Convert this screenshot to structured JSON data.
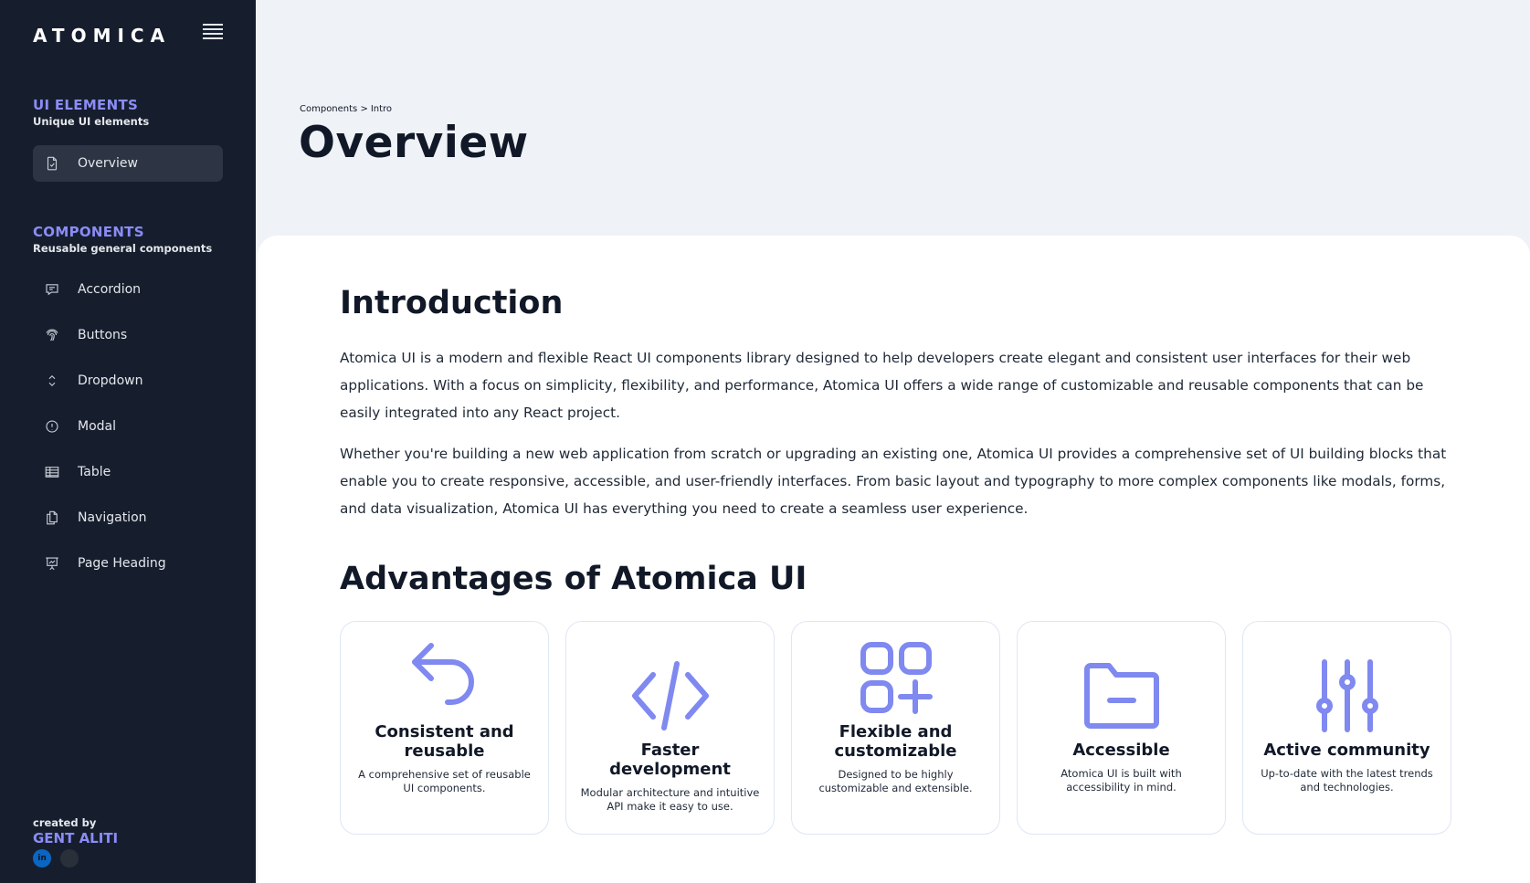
{
  "sidebar": {
    "logo": "ATOMICA",
    "sections": [
      {
        "title": "UI ELEMENTS",
        "subtitle": "Unique UI elements"
      },
      {
        "title": "COMPONENTS",
        "subtitle": "Reusable general components"
      }
    ],
    "items": [
      {
        "label": "Overview",
        "icon": "document-check-icon"
      },
      {
        "label": "Accordion",
        "icon": "chat-bubble-icon"
      },
      {
        "label": "Buttons",
        "icon": "finger-print-icon"
      },
      {
        "label": "Dropdown",
        "icon": "chevron-up-down-icon"
      },
      {
        "label": "Modal",
        "icon": "exclamation-circle-icon"
      },
      {
        "label": "Table",
        "icon": "table-icon"
      },
      {
        "label": "Navigation",
        "icon": "documents-icon"
      },
      {
        "label": "Page Heading",
        "icon": "presentation-chart-icon"
      }
    ],
    "credit": {
      "label": "created by",
      "name": "GENT ALITI",
      "socials": [
        "in",
        "gh"
      ]
    }
  },
  "header": {
    "breadcrumb": [
      "Components >",
      "Intro"
    ],
    "title": "Overview"
  },
  "main": {
    "intro_heading": "Introduction",
    "intro_paragraphs": [
      "Atomica UI is a modern and flexible React UI components library designed to help developers create elegant and consistent user interfaces for their web applications. With a focus on simplicity, flexibility, and performance, Atomica UI offers a wide range of customizable and reusable components that can be easily integrated into any React project.",
      "Whether you're building a new web application from scratch or upgrading an existing one, Atomica UI provides a comprehensive set of UI building blocks that enable you to create responsive, accessible, and user-friendly interfaces. From basic layout and typography to more complex components like modals, forms, and data visualization, Atomica UI has everything you need to create a seamless user experience."
    ],
    "advantages_heading": "Advantages of Atomica UI",
    "cards": [
      {
        "title": "Consistent and reusable",
        "desc": "A comprehensive set of reusable UI components.",
        "icon": "arrow-uturn-left-icon"
      },
      {
        "title": "Faster development",
        "desc": "Modular architecture and intuitive API make it easy to use.",
        "icon": "code-bracket-icon"
      },
      {
        "title": "Flexible and customizable",
        "desc": "Designed to be highly customizable and extensible.",
        "icon": "squares-plus-icon"
      },
      {
        "title": "Accessible",
        "desc": "Atomica UI is built with accessibility in mind.",
        "icon": "folder-minus-icon"
      },
      {
        "title": "Active community",
        "desc": "Up-to-date with the latest trends and technologies.",
        "icon": "adjustments-vertical-icon"
      }
    ]
  },
  "colors": {
    "accent": "#8b8cf6",
    "sidebar_bg": "#161e2e",
    "page_bg": "#eff2f7",
    "icon_stroke": "#7f89f0"
  }
}
